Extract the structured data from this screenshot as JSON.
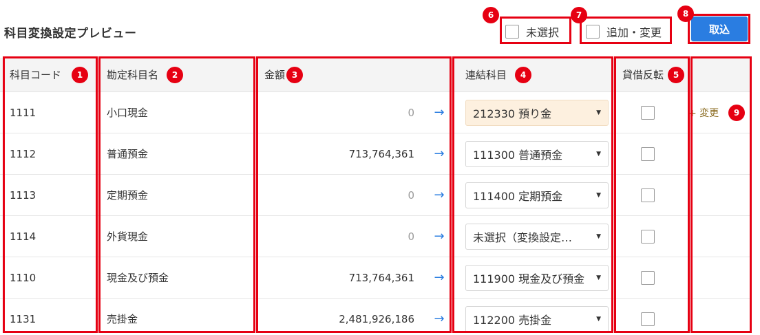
{
  "page": {
    "title": "科目変換設定プレビュー"
  },
  "filters": {
    "unselected_label": "未選択",
    "add_change_label": "追加・変更"
  },
  "toolbar": {
    "import_label": "取込"
  },
  "table": {
    "headers": {
      "code": "科目コード",
      "name": "勘定科目名",
      "amount": "金額",
      "linked": "連結科目",
      "reverse": "貸借反転"
    },
    "rows": [
      {
        "code": "1111",
        "name": "小口現金",
        "amount": "0",
        "linked": "212330 預り金",
        "highlight": true,
        "change": "+ 変更"
      },
      {
        "code": "1112",
        "name": "普通預金",
        "amount": "713,764,361",
        "linked": "111300 普通預金",
        "change": ""
      },
      {
        "code": "1113",
        "name": "定期預金",
        "amount": "0",
        "linked": "111400 定期預金",
        "change": ""
      },
      {
        "code": "1114",
        "name": "外貨現金",
        "amount": "0",
        "linked": "未選択（変換設定…",
        "change": ""
      },
      {
        "code": "1110",
        "name": "現金及び預金",
        "amount": "713,764,361",
        "linked": "111900 現金及び預金",
        "change": ""
      },
      {
        "code": "1131",
        "name": "売掛金",
        "amount": "2,481,926,186",
        "linked": "112200 売掛金",
        "change": ""
      }
    ]
  },
  "annotations": {
    "b1": "1",
    "b2": "2",
    "b3": "3",
    "b4": "4",
    "b5": "5",
    "b6": "6",
    "b7": "7",
    "b8": "8",
    "b9": "9"
  },
  "icons": {
    "arrow": "arrow-right-icon",
    "caret": "caret-down-icon",
    "checkbox": "checkbox-icon"
  },
  "colors": {
    "accent": "#2a7de1",
    "annotation": "#e60012",
    "highlight": "#fdf0df"
  }
}
